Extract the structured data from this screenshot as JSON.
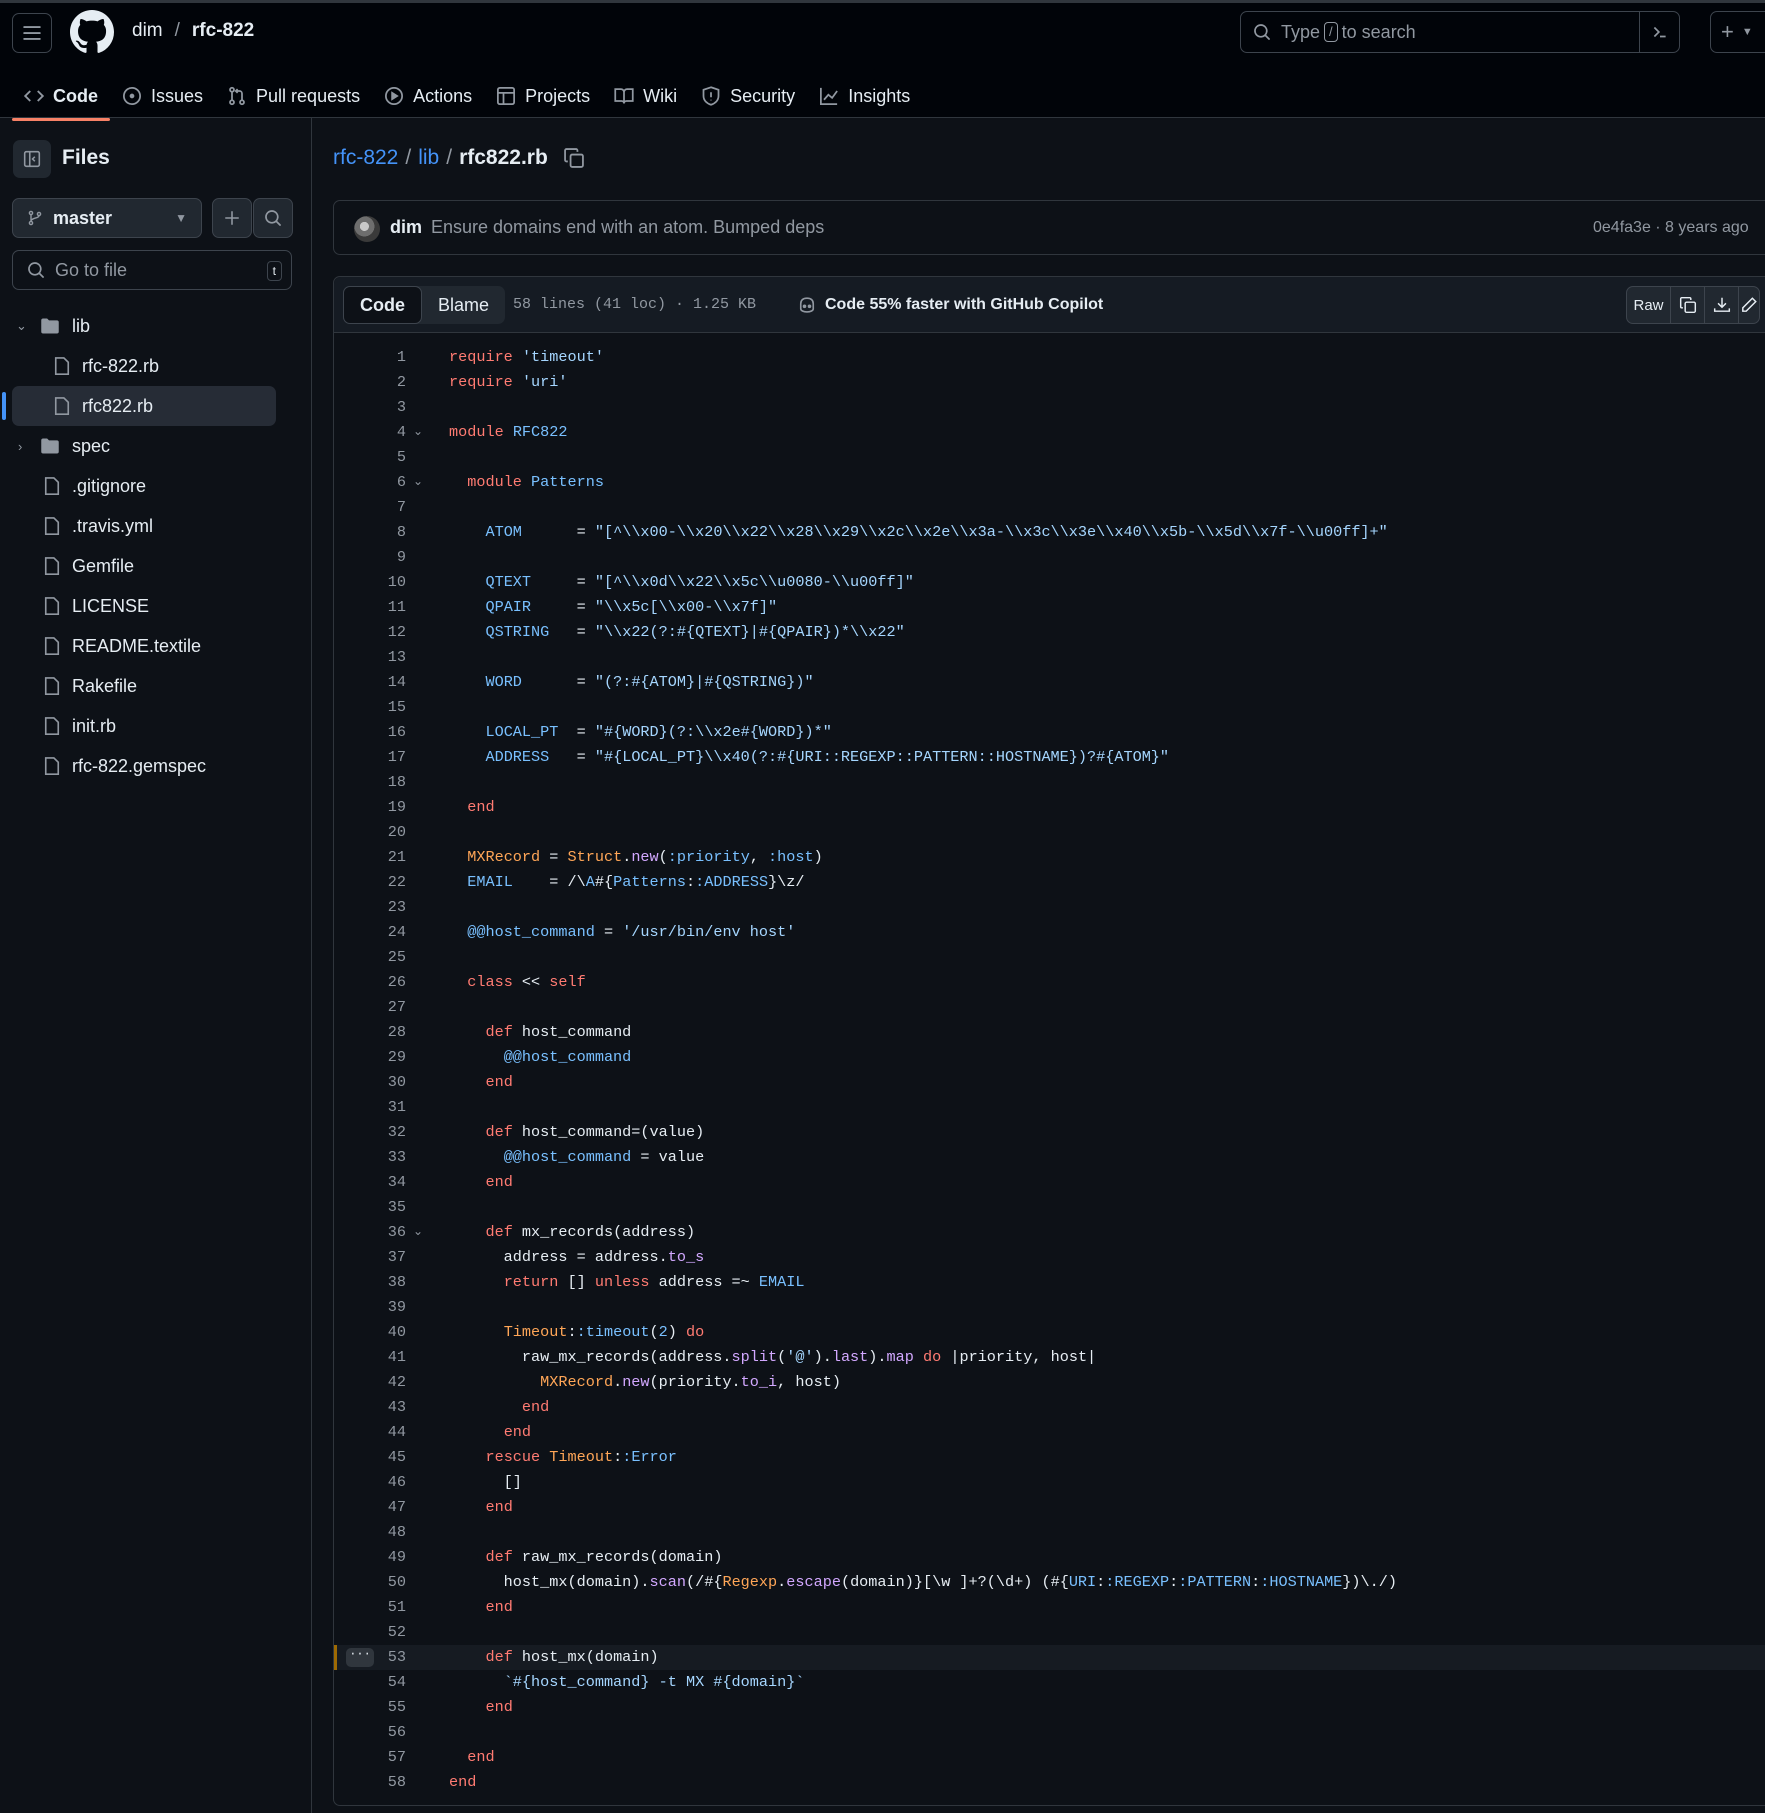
{
  "header": {
    "owner": "dim",
    "separator": "/",
    "repo": "rfc-822",
    "search_prefix": "Type",
    "search_key": "/",
    "search_suffix": "to search",
    "plus_label": "+"
  },
  "nav": [
    {
      "label": "Code",
      "icon": "code-icon"
    },
    {
      "label": "Issues",
      "icon": "issue-opened-icon"
    },
    {
      "label": "Pull requests",
      "icon": "git-pull-request-icon"
    },
    {
      "label": "Actions",
      "icon": "play-icon"
    },
    {
      "label": "Projects",
      "icon": "table-icon"
    },
    {
      "label": "Wiki",
      "icon": "book-icon"
    },
    {
      "label": "Security",
      "icon": "shield-icon"
    },
    {
      "label": "Insights",
      "icon": "graph-icon"
    }
  ],
  "sidebar": {
    "title": "Files",
    "branch": "master",
    "goto_placeholder": "Go to file",
    "goto_key": "t",
    "tree": [
      {
        "label": "lib",
        "type": "folder",
        "expanded": true
      },
      {
        "label": "rfc-822.rb",
        "type": "file",
        "nested": true
      },
      {
        "label": "rfc822.rb",
        "type": "file",
        "nested": true,
        "selected": true
      },
      {
        "label": "spec",
        "type": "folder",
        "expanded": false
      },
      {
        "label": ".gitignore",
        "type": "file"
      },
      {
        "label": ".travis.yml",
        "type": "file"
      },
      {
        "label": "Gemfile",
        "type": "file"
      },
      {
        "label": "LICENSE",
        "type": "file"
      },
      {
        "label": "README.textile",
        "type": "file"
      },
      {
        "label": "Rakefile",
        "type": "file"
      },
      {
        "label": "init.rb",
        "type": "file"
      },
      {
        "label": "rfc-822.gemspec",
        "type": "file"
      }
    ]
  },
  "breadcrumb": {
    "repo": "rfc-822",
    "sep": "/",
    "folder": "lib",
    "file": "rfc822.rb"
  },
  "commit": {
    "author": "dim",
    "message": "Ensure domains end with an atom. Bumped deps",
    "meta": "0e4fa3e · 8 years ago"
  },
  "file": {
    "tab_code": "Code",
    "tab_blame": "Blame",
    "stats": "58 lines (41 loc) · 1.25 KB",
    "copilot": "Code 55% faster with GitHub Copilot",
    "raw_label": "Raw",
    "lines": [
      "require 'timeout'",
      "require 'uri'",
      "",
      "module RFC822",
      "",
      "  module Patterns",
      "",
      "    ATOM      = \"[^\\\\x00-\\\\x20\\\\x22\\\\x28\\\\x29\\\\x2c\\\\x2e\\\\x3a-\\\\x3c\\\\x3e\\\\x40\\\\x5b-\\\\x5d\\\\x7f-\\\\u00ff]+\"",
      "",
      "    QTEXT     = \"[^\\\\x0d\\\\x22\\\\x5c\\\\u0080-\\\\u00ff]\"",
      "    QPAIR     = \"\\\\x5c[\\\\x00-\\\\x7f]\"",
      "    QSTRING   = \"\\\\x22(?:#{QTEXT}|#{QPAIR})*\\\\x22\"",
      "",
      "    WORD      = \"(?:#{ATOM}|#{QSTRING})\"",
      "",
      "    LOCAL_PT  = \"#{WORD}(?:\\\\x2e#{WORD})*\"",
      "    ADDRESS   = \"#{LOCAL_PT}\\\\x40(?:#{URI::REGEXP::PATTERN::HOSTNAME})?#{ATOM}\"",
      "",
      "  end",
      "",
      "  MXRecord = Struct.new(:priority, :host)",
      "  EMAIL    = /\\A#{Patterns::ADDRESS}\\z/",
      "",
      "  @@host_command = '/usr/bin/env host'",
      "",
      "  class << self",
      "",
      "    def host_command",
      "      @@host_command",
      "    end",
      "",
      "    def host_command=(value)",
      "      @@host_command = value",
      "    end",
      "",
      "    def mx_records(address)",
      "      address = address.to_s",
      "      return [] unless address =~ EMAIL",
      "",
      "      Timeout::timeout(2) do",
      "        raw_mx_records(address.split('@').last).map do |priority, host|",
      "          MXRecord.new(priority.to_i, host)",
      "        end",
      "      end",
      "    rescue Timeout::Error",
      "      []",
      "    end",
      "",
      "    def raw_mx_records(domain)",
      "      host_mx(domain).scan(/#{Regexp.escape(domain)}[\\w ]+?(\\d+) (#{URI::REGEXP::PATTERN::HOSTNAME})\\./)",
      "    end",
      "",
      "    def host_mx(domain)",
      "      `#{host_command} -t MX #{domain}`",
      "    end",
      "",
      "  end",
      "end"
    ],
    "fold_lines": [
      4,
      6,
      36
    ],
    "highlight_line": 53
  },
  "colors": {
    "accent_underline": "#f78166",
    "link": "#4493f8",
    "keyword": "#ff7b72",
    "string": "#a5d6ff",
    "constant": "#79c0ff",
    "function": "#d2a8ff",
    "class": "#ffa657"
  }
}
